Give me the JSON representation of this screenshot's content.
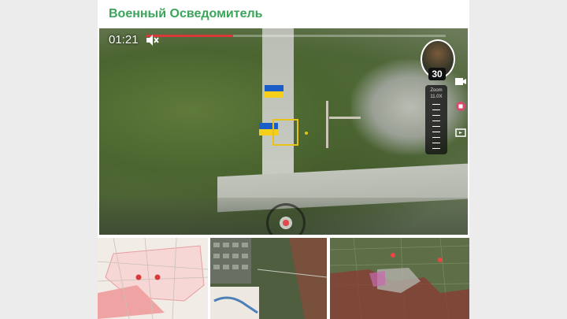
{
  "channel": {
    "name": "Военный Осведомитель"
  },
  "video": {
    "timecode": "01:21",
    "progress": 0.0,
    "avatar_badge": "30",
    "zoom_label": "Zoom",
    "zoom_value": "11.0X"
  },
  "maps": [
    {
      "name": "city-map-red-markers"
    },
    {
      "name": "satellite-map-collage"
    },
    {
      "name": "satellite-map-frontline"
    }
  ],
  "colors": {
    "channel_name": "#3ba55a",
    "ua_flag_blue": "#1a5dc9",
    "ua_flag_yellow": "#f5cf1a",
    "target_box": "#e6c21a",
    "progress_green": "#19d27a",
    "progress_red": "#d8383a"
  },
  "icons": {
    "mute": "mute-icon",
    "camera": "camera-icon",
    "record": "record-icon",
    "screen": "screen-icon"
  }
}
